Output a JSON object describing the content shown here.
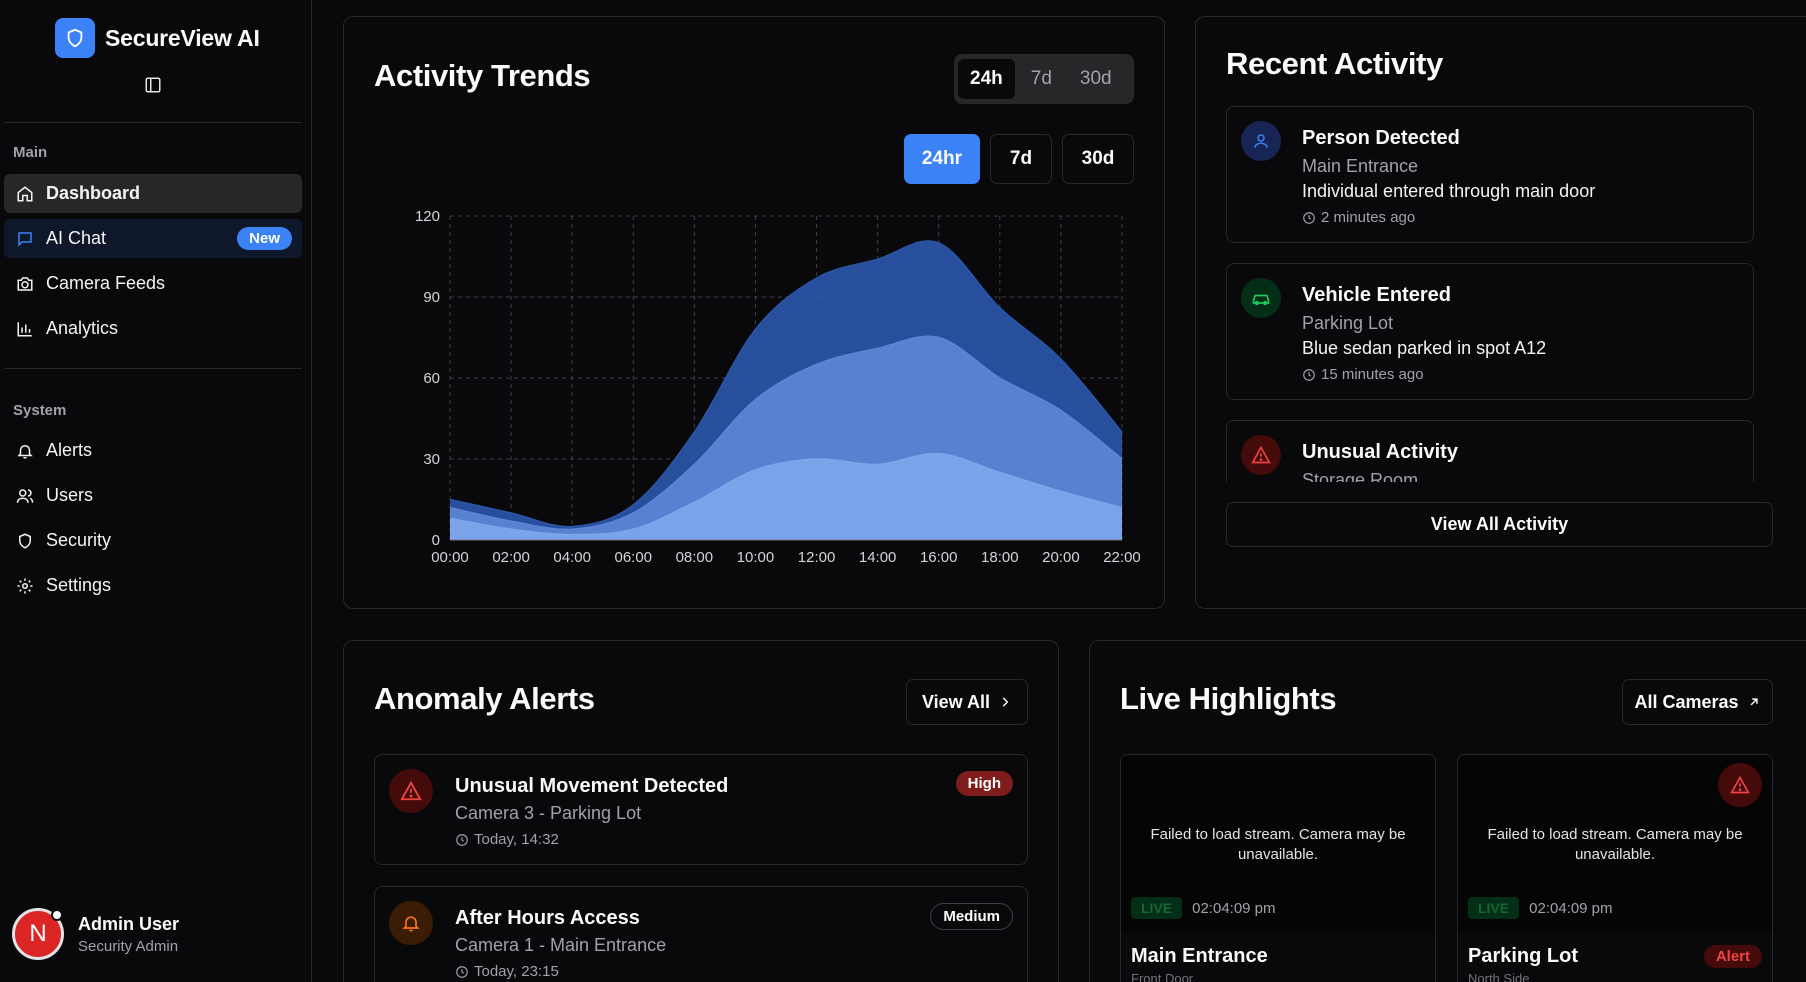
{
  "app": {
    "name": "SecureView AI"
  },
  "sidebar": {
    "sections": [
      {
        "label": "Main"
      },
      {
        "label": "System"
      }
    ],
    "items": [
      {
        "label": "Dashboard",
        "icon": "home-icon"
      },
      {
        "label": "AI Chat",
        "icon": "chat-icon",
        "badge": "New"
      },
      {
        "label": "Camera Feeds",
        "icon": "camera-icon"
      },
      {
        "label": "Analytics",
        "icon": "bar-chart-icon"
      },
      {
        "label": "Alerts",
        "icon": "bell-icon"
      },
      {
        "label": "Users",
        "icon": "users-icon"
      },
      {
        "label": "Security",
        "icon": "shield-icon"
      },
      {
        "label": "Settings",
        "icon": "gear-icon"
      }
    ],
    "user": {
      "initial": "N",
      "name": "Admin User",
      "role": "Security Admin"
    }
  },
  "activity_trends": {
    "title": "Activity Trends",
    "segment": [
      "24h",
      "7d",
      "30d"
    ],
    "segment_active": "24h",
    "ranges": [
      "24hr",
      "7d",
      "30d"
    ],
    "range_active": "24hr"
  },
  "chart_data": {
    "type": "area",
    "stacked": false,
    "x": [
      "00:00",
      "02:00",
      "04:00",
      "06:00",
      "08:00",
      "10:00",
      "12:00",
      "14:00",
      "16:00",
      "18:00",
      "20:00",
      "22:00"
    ],
    "series": [
      {
        "color": "#2a56a8",
        "values": [
          15,
          10,
          5,
          13,
          40,
          78,
          97,
          104,
          110,
          86,
          67,
          40
        ]
      },
      {
        "color": "#5b86d6",
        "values": [
          12,
          7,
          4,
          10,
          28,
          52,
          65,
          71,
          75,
          60,
          48,
          30
        ]
      },
      {
        "color": "#7ea6ea",
        "values": [
          8,
          4,
          2,
          4,
          14,
          26,
          30,
          28,
          32,
          25,
          18,
          12
        ]
      }
    ],
    "ylim": [
      0,
      120
    ],
    "yticks": [
      0,
      30,
      60,
      90,
      120
    ],
    "grid": true,
    "xlabel": "",
    "ylabel": ""
  },
  "recent_activity": {
    "title": "Recent Activity",
    "items": [
      {
        "icon": "person-icon",
        "icon_color": "#3b82f6",
        "title": "Person Detected",
        "location": "Main Entrance",
        "description": "Individual entered through main door",
        "time": "2 minutes ago"
      },
      {
        "icon": "car-icon",
        "icon_color": "#22c55e",
        "title": "Vehicle Entered",
        "location": "Parking Lot",
        "description": "Blue sedan parked in spot A12",
        "time": "15 minutes ago"
      },
      {
        "icon": "warning-icon",
        "icon_color": "#ef4444",
        "title": "Unusual Activity",
        "location": "Storage Room"
      }
    ],
    "view_all": "View All Activity"
  },
  "anomaly_alerts": {
    "title": "Anomaly Alerts",
    "view_all": "View All",
    "items": [
      {
        "icon": "warning-icon",
        "title": "Unusual Movement Detected",
        "location": "Camera 3 - Parking Lot",
        "time": "Today, 14:32",
        "severity": "High"
      },
      {
        "icon": "bell-icon",
        "title": "After Hours Access",
        "location": "Camera 1 - Main Entrance",
        "time": "Today, 23:15",
        "severity": "Medium"
      }
    ]
  },
  "live_highlights": {
    "title": "Live Highlights",
    "all_cameras": "All Cameras",
    "cameras": [
      {
        "message": "Failed to load stream. Camera may be unavailable.",
        "live": "LIVE",
        "time": "02:04:09 pm",
        "name": "Main Entrance",
        "sub": "Front Door"
      },
      {
        "message": "Failed to load stream. Camera may be unavailable.",
        "live": "LIVE",
        "time": "02:04:09 pm",
        "name": "Parking Lot",
        "sub": "North Side",
        "badge": "Alert"
      }
    ]
  }
}
